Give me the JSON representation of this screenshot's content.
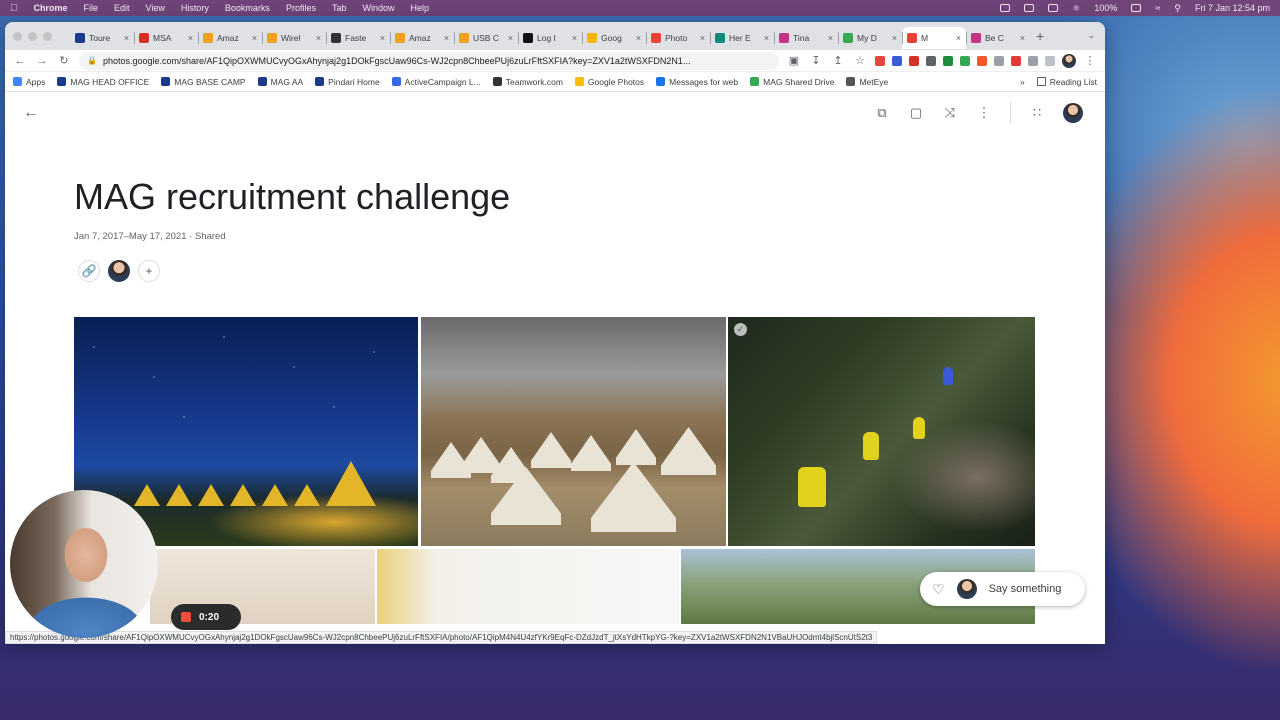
{
  "menubar": {
    "app": "Chrome",
    "items": [
      "File",
      "Edit",
      "View",
      "History",
      "Bookmarks",
      "Profiles",
      "Tab",
      "Window",
      "Help"
    ],
    "battery": "100%",
    "datetime": "Fri 7 Jan  12:54 pm"
  },
  "tabs": [
    {
      "label": "Toure",
      "color": "#1a3a8a"
    },
    {
      "label": "MSA",
      "color": "#d93025"
    },
    {
      "label": "Amaz",
      "color": "#f0a020"
    },
    {
      "label": "Wirel",
      "color": "#f0a020"
    },
    {
      "label": "Faste",
      "color": "#333333"
    },
    {
      "label": "Amaz",
      "color": "#f0a020"
    },
    {
      "label": "USB C",
      "color": "#f0a020"
    },
    {
      "label": "Log I",
      "color": "#111111"
    },
    {
      "label": "Goog",
      "color": "#f4b400"
    },
    {
      "label": "Photo",
      "color": "#ea4335"
    },
    {
      "label": "Her E",
      "color": "#0a8a7a"
    },
    {
      "label": "Tina",
      "color": "#c13584"
    },
    {
      "label": "My D",
      "color": "#34a853"
    },
    {
      "label": "M",
      "color": "#ea4335",
      "active": true
    },
    {
      "label": "Be C",
      "color": "#c13584"
    }
  ],
  "address": {
    "url": "photos.google.com/share/AF1QipOXWMUCvyOGxAhynjaj2g1DOkFgscUaw96Cs-WJ2cpn8ChbeePUj6zuLrFftSXFIA?key=ZXV1a2tWSXFDN2N1..."
  },
  "bookmarks": [
    {
      "label": "Apps",
      "color": "#4285f4"
    },
    {
      "label": "MAG HEAD OFFICE",
      "color": "#1a3a8a"
    },
    {
      "label": "MAG BASE CAMP",
      "color": "#1a3a8a"
    },
    {
      "label": "MAG AA",
      "color": "#1a3a8a"
    },
    {
      "label": "Pindari Home",
      "color": "#1a3a8a"
    },
    {
      "label": "ActiveCampaign L...",
      "color": "#356ae6"
    },
    {
      "label": "Teamwork.com",
      "color": "#333333"
    },
    {
      "label": "Google Photos",
      "color": "#fbbc04"
    },
    {
      "label": "Messages for web",
      "color": "#1a73e8"
    },
    {
      "label": "MAG Shared Drive",
      "color": "#34a853"
    },
    {
      "label": "MetEye",
      "color": "#555555"
    }
  ],
  "bookmarks_more": "»",
  "reading_list": "Reading List",
  "album": {
    "title": "MAG recruitment challenge",
    "daterange": "Jan 7, 2017–May 17, 2021 · Shared"
  },
  "comment_box": {
    "placeholder": "Say something"
  },
  "status_url": "https://photos.google.com/share/AF1QipOXWMUCvyOGxAhynjaj2g1DOkFgscUaw96Cs-WJ2cpn8ChbeePUj6zuLrFftSXFIA/photo/AF1QipM4N4U4zfYKr9EqFc-DZdJzdT_jtXsYdHTkpYG-?key=ZXV1a2tWSXFDN2N1VBaUHJOdmt4bjlScnUtS2t3",
  "recording": {
    "timer": "0:20"
  },
  "icons": {
    "back": "arrow-left-icon",
    "add_photos": "add-photo-icon",
    "slideshow": "slideshow-icon",
    "share": "share-icon",
    "more": "more-vert-icon",
    "apps": "apps-grid-icon",
    "link": "link-icon",
    "add_person": "plus-icon",
    "heart": "heart-icon"
  }
}
